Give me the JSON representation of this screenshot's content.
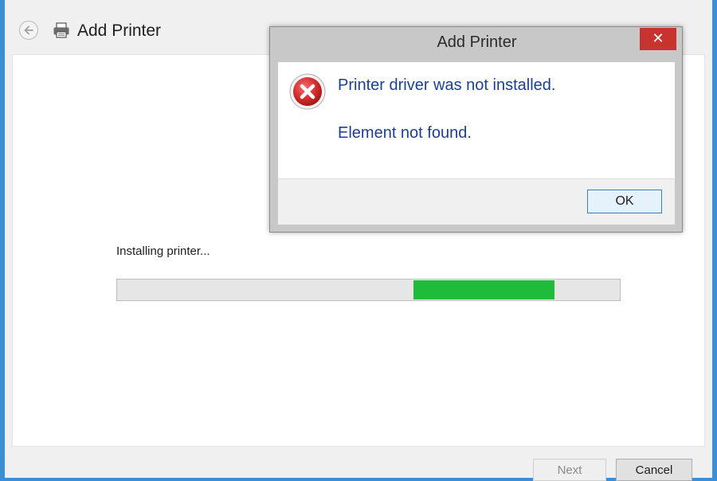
{
  "wizard": {
    "title": "Add Printer",
    "status_text": "Installing printer...",
    "progress": {
      "start_fraction": 0.59,
      "end_fraction": 0.87
    },
    "next_label": "Next",
    "cancel_label": "Cancel"
  },
  "dialog": {
    "title": "Add Printer",
    "close_glyph": "✕",
    "message": "Printer driver was not installed.",
    "detail": "Element not found.",
    "ok_label": "OK",
    "icon": "error-icon"
  },
  "colors": {
    "progress": "#1fbc3b",
    "close_button": "#c7332f",
    "message_text": "#1e3f8f"
  }
}
